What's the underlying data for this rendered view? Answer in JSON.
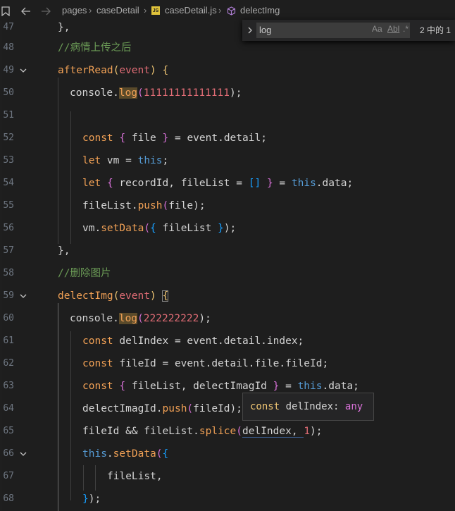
{
  "breadcrumb": {
    "items": [
      "pages",
      "caseDetail",
      "caseDetail.js",
      "delectImg"
    ],
    "file_badge": "JS"
  },
  "find": {
    "query": "log",
    "opt_case": "Aa",
    "opt_word": "Abl",
    "opt_regex": ".*",
    "count": "2 中的 1"
  },
  "tooltip": {
    "kw": "const",
    "name": "delIndex:",
    "type": "any"
  },
  "lines": {
    "l47": {
      "num": "47",
      "t": [
        "},"
      ]
    },
    "l48": {
      "num": "48",
      "t": [
        "//病情上传之后"
      ]
    },
    "l49": {
      "num": "49",
      "t": [
        "afterRead",
        "(",
        "event",
        ")",
        " ",
        "{"
      ]
    },
    "l50": {
      "num": "50",
      "t": [
        "console.",
        "log",
        "(",
        "11111111111111",
        ");"
      ]
    },
    "l51": {
      "num": "51",
      "t": []
    },
    "l52": {
      "num": "52",
      "t": [
        "const",
        " ",
        "{",
        " file ",
        "}",
        " = event.detail;"
      ]
    },
    "l53": {
      "num": "53",
      "t": [
        "let",
        " vm = ",
        "this",
        ";"
      ]
    },
    "l54": {
      "num": "54",
      "t": [
        "let",
        " ",
        "{",
        " recordId, fileList = ",
        "[]",
        " ",
        "}",
        " = ",
        "this",
        ".data;"
      ]
    },
    "l55": {
      "num": "55",
      "t": [
        "fileList.",
        "push",
        "(",
        "file",
        ");"
      ]
    },
    "l56": {
      "num": "56",
      "t": [
        "vm.",
        "setData",
        "(",
        "{",
        " fileList ",
        "}",
        ");"
      ]
    },
    "l57": {
      "num": "57",
      "t": [
        "},"
      ]
    },
    "l58": {
      "num": "58",
      "t": [
        "//删除图片"
      ]
    },
    "l59": {
      "num": "59",
      "t": [
        "delectImg",
        "(",
        "event",
        ")",
        " ",
        "{"
      ]
    },
    "l60": {
      "num": "60",
      "t": [
        "console.",
        "log",
        "(",
        "222222222",
        ");"
      ]
    },
    "l61": {
      "num": "61",
      "t": [
        "const",
        " delIndex = event.detail.index;"
      ]
    },
    "l62": {
      "num": "62",
      "t": [
        "const",
        " fileId = event.detail.file.fileId;"
      ]
    },
    "l63": {
      "num": "63",
      "t": [
        "const",
        " ",
        "{",
        " fileList, delectImagId ",
        "}",
        " = ",
        "this",
        ".data;"
      ]
    },
    "l64": {
      "num": "64",
      "t": [
        "delectImagId.",
        "push",
        "(",
        "fileId",
        ");"
      ]
    },
    "l65": {
      "num": "65",
      "t": [
        "fileId && fileList.",
        "splice",
        "(",
        "delIndex, ",
        "1",
        ");"
      ]
    },
    "l66": {
      "num": "66",
      "t": [
        "this",
        ".",
        "setData",
        "(",
        "{"
      ]
    },
    "l67": {
      "num": "67",
      "t": [
        "fileList,"
      ]
    },
    "l68": {
      "num": "68",
      "t": [
        "}",
        ");"
      ]
    }
  }
}
